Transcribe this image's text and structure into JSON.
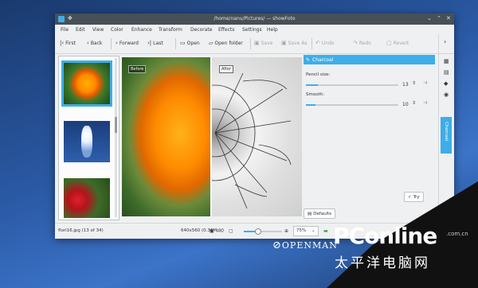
{
  "window": {
    "title": "/home/nanu/Pictures/ — showFoto"
  },
  "menu": [
    "File",
    "Edit",
    "View",
    "Color",
    "Enhance",
    "Transform",
    "Decorate",
    "Effects",
    "Settings",
    "Help"
  ],
  "toolbar": {
    "first": "First",
    "back": "Back",
    "forward": "Forward",
    "last": "Last",
    "open": "Open",
    "open_folder": "Open folder",
    "save": "Save",
    "save_as": "Save As",
    "undo": "Undo",
    "redo": "Redo",
    "revert": "Revert"
  },
  "preview": {
    "before_label": "Before",
    "after_label": "After"
  },
  "panel": {
    "title": "Charcoal",
    "pencil_label": "Pencil size:",
    "pencil_value": "13",
    "pencil_fraction": 0.13,
    "smooth_label": "Smooth:",
    "smooth_value": "10",
    "smooth_fraction": 0.1,
    "try_label": "Try",
    "defaults_label": "Defaults"
  },
  "rightbar": {
    "tab_label": "Charcoal"
  },
  "status": {
    "filename": "flori16.jpg (13 of 34)",
    "dimensions": "640x560 (0.36Mpx)",
    "zoom": "75%"
  },
  "watermark": {
    "openman": "OPENMAN",
    "pconline": "PConline",
    "pconline_domain": ".com.cn",
    "pconline_cn": "太平洋电脑网"
  },
  "colors": {
    "accent": "#3daee9",
    "titlebar": "#475057"
  },
  "icons": [
    "app-icon",
    "pin-icon",
    "minimize-icon",
    "maximize-icon",
    "close-icon",
    "first-icon",
    "back-icon",
    "forward-icon",
    "last-icon",
    "open-icon",
    "open-folder-icon",
    "save-icon",
    "save-as-icon",
    "undo-icon",
    "redo-icon",
    "revert-icon",
    "more-icon",
    "pencil-icon",
    "try-icon",
    "defaults-icon",
    "zoom-fit-icon"
  ]
}
